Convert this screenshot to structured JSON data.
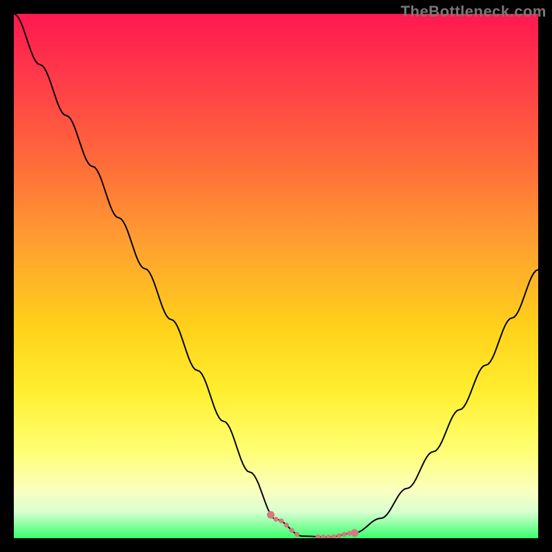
{
  "watermark": "TheBottleneck.com",
  "chart_data": {
    "type": "line",
    "title": "",
    "xlabel": "",
    "ylabel": "",
    "xlim": [
      0,
      100
    ],
    "ylim": [
      0,
      100
    ],
    "x": [
      0,
      5,
      10,
      15,
      20,
      25,
      30,
      35,
      40,
      45,
      50,
      55,
      60,
      65,
      70,
      75,
      80,
      85,
      90,
      95,
      100
    ],
    "values": [
      100,
      90.3,
      80.6,
      70.9,
      61.1,
      51.4,
      41.7,
      32.0,
      22.3,
      12.6,
      3.6,
      0.4,
      0.2,
      1.0,
      3.8,
      9.5,
      16.5,
      24.5,
      33.0,
      42.0,
      51.2
    ],
    "min_x": 58,
    "highlight_points_x": [
      49,
      50,
      51,
      52,
      53,
      54,
      58,
      59,
      60,
      61,
      62,
      63,
      64,
      65
    ]
  },
  "colors": {
    "gradient_top": "#ff1850",
    "gradient_bottom": "#3aff70",
    "curve": "#000000",
    "dots": "#d67b7d",
    "frame": "#000000"
  }
}
